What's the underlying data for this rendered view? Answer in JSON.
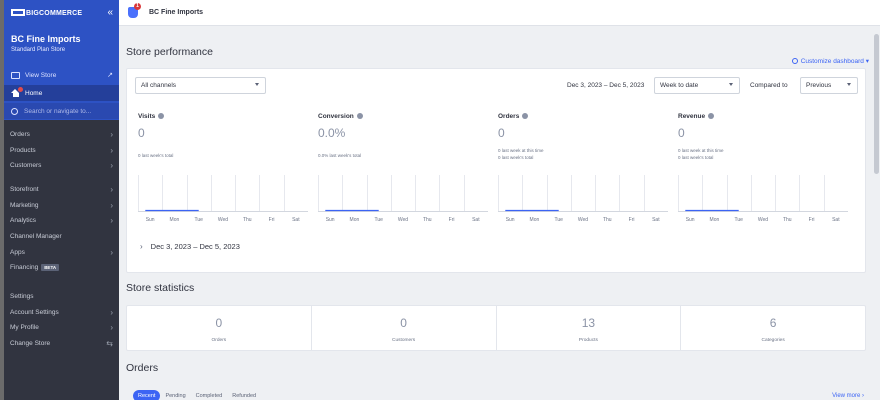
{
  "sidebar": {
    "brand": "BIGCOMMERCE",
    "collapse": "«",
    "store_name": "BC Fine Imports",
    "store_plan": "Standard Plan Store",
    "view_store": "View Store",
    "view_store_ext": "↗",
    "home": "Home",
    "search_placeholder": "Search or navigate to...",
    "nav_group1": [
      {
        "label": "Orders",
        "chev": "›"
      },
      {
        "label": "Products",
        "chev": "›"
      },
      {
        "label": "Customers",
        "chev": "›"
      }
    ],
    "nav_group2": [
      {
        "label": "Storefront",
        "chev": "›"
      },
      {
        "label": "Marketing",
        "chev": "›"
      },
      {
        "label": "Analytics",
        "chev": "›"
      },
      {
        "label": "Channel Manager",
        "chev": ""
      },
      {
        "label": "Apps",
        "chev": "›"
      },
      {
        "label": "Financing",
        "chev": "",
        "badge": "BETA"
      }
    ],
    "nav_group3": [
      {
        "label": "Settings",
        "chev": ""
      },
      {
        "label": "Account Settings",
        "chev": "›"
      },
      {
        "label": "My Profile",
        "chev": "›"
      },
      {
        "label": "Change Store",
        "chev": "⇆"
      }
    ]
  },
  "topbar": {
    "notif_count": "1",
    "title": "BC Fine Imports"
  },
  "main": {
    "performance_title": "Store performance",
    "customize_label": "Customize dashboard",
    "customize_caret": "▾",
    "channel_select": "All channels",
    "date_range": "Dec 3, 2023 – Dec 5, 2023",
    "period_select": "Week to date",
    "compared_label": "Compared to",
    "compared_select": "Previous",
    "metrics": [
      {
        "label": "Visits",
        "value": "0",
        "sub1": "0 last week's total",
        "sub2": ""
      },
      {
        "label": "Conversion",
        "value": "0.0%",
        "sub1": "0.0% last week's total",
        "sub2": ""
      },
      {
        "label": "Orders",
        "value": "0",
        "sub1": "0 last week at this time",
        "sub2": "0 last week's total"
      },
      {
        "label": "Revenue",
        "value": "0",
        "sub1": "0 last week at this time",
        "sub2": "0 last week's total"
      }
    ],
    "days": [
      "Sun",
      "Mon",
      "Tue",
      "Wed",
      "Thu",
      "Fri",
      "Sat"
    ],
    "range_chev": "›",
    "range_label": "Dec 3, 2023 – Dec 5, 2023",
    "statistics_title": "Store statistics",
    "stats": [
      {
        "value": "0",
        "label": "Orders"
      },
      {
        "value": "0",
        "label": "Customers"
      },
      {
        "value": "13",
        "label": "Products"
      },
      {
        "value": "6",
        "label": "Categories"
      }
    ],
    "orders_title": "Orders",
    "order_tabs": [
      "Recent",
      "Pending",
      "Completed",
      "Refunded"
    ],
    "view_more": "View more ›"
  },
  "colors": {
    "accent": "#3c64f4",
    "sidebar": "#313440",
    "sidebar_top": "#2d52c4"
  }
}
